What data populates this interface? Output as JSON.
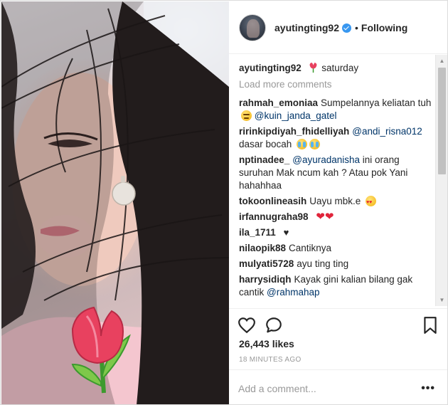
{
  "post_header": {
    "username": "ayutingting92",
    "separator": "•",
    "follow_label": "Following"
  },
  "caption": {
    "username": "ayutingting92",
    "text": "saturday",
    "emoji": "tulip-emoji"
  },
  "load_more": "Load more comments",
  "comments": [
    {
      "user": "rahmah_emoniaa",
      "text": "Sumpelannya keliatan tuh",
      "mention": "@kuin_janda_gatel",
      "emoji": "angry-face-emoji"
    },
    {
      "user": "ririnkipdiyah_fhidelliyah",
      "mention": "@andi_risna012",
      "text": "dasar bocah",
      "emoji": "crying-face-emoji"
    },
    {
      "user": "nptinadee_",
      "mention": "@ayuradanisha",
      "text": "ini orang suruhan Mak ncum kah ? Atau pok Yani hahahhaa"
    },
    {
      "user": "tokoonlineasih",
      "text": "Uayu mbk.e",
      "emoji": "heart-eyes-emoji"
    },
    {
      "user": "irfannugraha98",
      "text": "",
      "emoji": "red-hearts-emoji",
      "hearts": "❤❤"
    },
    {
      "user": "ila_1711",
      "text": "",
      "emoji": "black-heart-emoji",
      "hearts": "♥"
    },
    {
      "user": "nilaopik88",
      "text": "Cantiknya"
    },
    {
      "user": "mulyati5728",
      "text": "ayu ting ting"
    },
    {
      "user": "harrysidiqh",
      "text": "Kayak gini kalian bilang gak cantik",
      "mention": "@rahmahap"
    }
  ],
  "likes": "26,443 likes",
  "timestamp": "18 MINUTES AGO",
  "add_comment_placeholder": "Add a comment...",
  "more_options": "•••",
  "icons": {
    "like": "heart-outline-icon",
    "comment": "comment-bubble-icon",
    "save": "bookmark-icon",
    "verified": "verified-badge-icon"
  },
  "colors": {
    "verified_blue": "#3897f0",
    "mention": "#003569",
    "muted": "#999999",
    "text": "#262626"
  }
}
